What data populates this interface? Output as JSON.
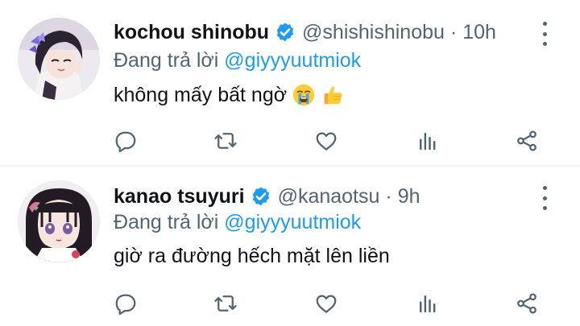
{
  "tweets": [
    {
      "display_name": "kochou shinobu",
      "handle": "@shishishinobu",
      "separator": "·",
      "time": "10h",
      "reply_prefix": "Đang trả lời",
      "reply_to": "@giyyyuutmiok",
      "text": "không mấy bất ngờ",
      "emojis": [
        "loudly-crying-face",
        "thumbs-up"
      ],
      "verified": true
    },
    {
      "display_name": "kanao tsuyuri",
      "handle": "@kanaotsu",
      "separator": "·",
      "time": "9h",
      "reply_prefix": "Đang trả lời",
      "reply_to": "@giyyyuutmiok",
      "text": "giờ ra đường hếch mặt lên liền",
      "emojis": [],
      "verified": true
    }
  ],
  "actions": [
    "reply-icon",
    "retweet-icon",
    "like-icon",
    "view-stats-icon",
    "share-icon"
  ],
  "colors": {
    "verified": "#1d9bf0",
    "mention": "#1d9bf0",
    "secondary_text": "#536471",
    "primary_text": "#0f1419",
    "divider": "#eff3f4"
  }
}
